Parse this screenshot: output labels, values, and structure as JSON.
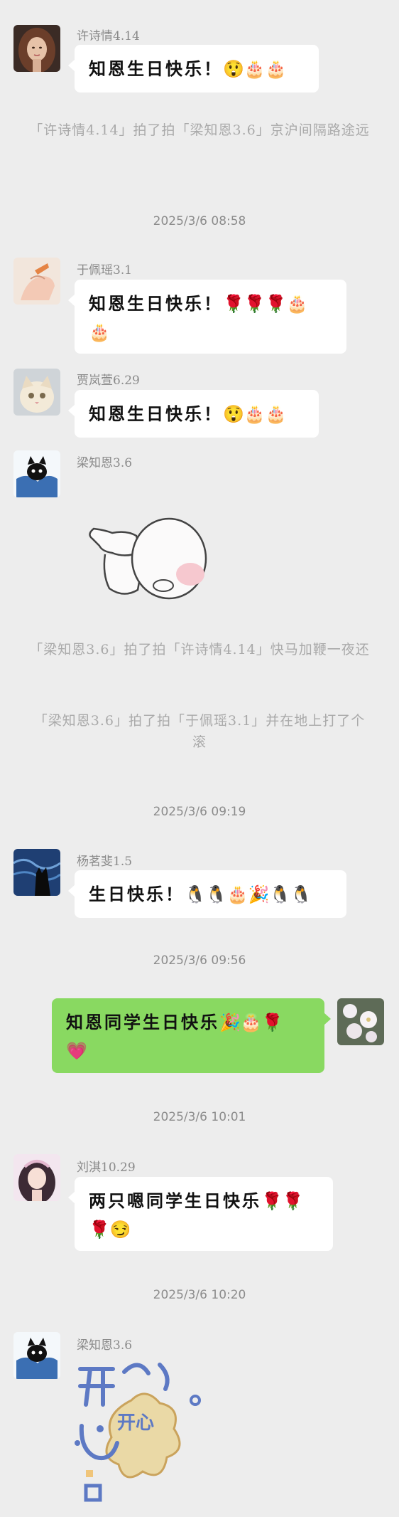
{
  "messages": [
    {
      "sender": "许诗情4.14",
      "text": "知恩生日快乐！",
      "emoji": "😲🎂🎂"
    },
    {
      "system": "「许诗情4.14」拍了拍「梁知恩3.6」京沪间隔路途远"
    },
    {
      "time": "2025/3/6 08:58"
    },
    {
      "sender": "于佩瑶3.1",
      "text": "知恩生日快乐！",
      "emoji": "🌹🌹🌹🎂🎂"
    },
    {
      "sender": "贾岚萱6.29",
      "text": "知恩生日快乐！",
      "emoji": "😲🎂🎂"
    },
    {
      "sender": "梁知恩3.6",
      "sticker": "bunny-bowing-sticker"
    },
    {
      "system": "「梁知恩3.6」拍了拍「许诗情4.14」快马加鞭一夜还"
    },
    {
      "system": "「梁知恩3.6」拍了拍「于佩瑶3.1」并在地上打了个滚"
    },
    {
      "time": "2025/3/6 09:19"
    },
    {
      "sender": "杨茗斐1.5",
      "text": "生日快乐！",
      "emoji": "🐧🐧🎂🎉🐧🐧"
    },
    {
      "time": "2025/3/6 09:56"
    },
    {
      "self": true,
      "text": "知恩同学生日快乐",
      "emoji": "🎉🎂🌹💗"
    },
    {
      "time": "2025/3/6 10:01"
    },
    {
      "sender": "刘淇10.29",
      "text": "两只嗯同学生日快乐",
      "emoji": "🌹🌹🌹😏"
    },
    {
      "time": "2025/3/6 10:20"
    },
    {
      "sender": "梁知恩3.6",
      "sticker": "kaixin-sticker",
      "sticker_text": "开心"
    }
  ],
  "m0": {
    "sender": "许诗情4.14",
    "text": "知恩生日快乐！",
    "emoji": "😲🎂🎂"
  },
  "sys1": "「许诗情4.14」拍了拍「梁知恩3.6」京沪间隔路途远",
  "t1": "2025/3/6 08:58",
  "m1": {
    "sender": "于佩瑶3.1",
    "text": "知恩生日快乐！",
    "emoji1": "🌹🌹🌹🎂",
    "emoji2": "🎂"
  },
  "m2": {
    "sender": "贾岚萱6.29",
    "text": "知恩生日快乐！",
    "emoji": "😲🎂🎂"
  },
  "m3": {
    "sender": "梁知恩3.6"
  },
  "sys2": "「梁知恩3.6」拍了拍「许诗情4.14」快马加鞭一夜还",
  "sys3": "「梁知恩3.6」拍了拍「于佩瑶3.1」并在地上打了个滚",
  "t2": "2025/3/6 09:19",
  "m4": {
    "sender": "杨茗斐1.5",
    "text": "生日快乐！",
    "emoji": "🐧🐧🎂🎉🐧🐧"
  },
  "t3": "2025/3/6 09:56",
  "m5": {
    "text": "知恩同学生日快乐",
    "emoji1": "🎉🎂🌹",
    "emoji2": "💗"
  },
  "t4": "2025/3/6 10:01",
  "m6": {
    "sender": "刘淇10.29",
    "text": "两只嗯同学生日快乐",
    "emoji1": "🌹🌹",
    "emoji2": "🌹😏"
  },
  "t5": "2025/3/6 10:20",
  "m7": {
    "sender": "梁知恩3.6",
    "sticker_text": "开心"
  },
  "colors": {
    "background": "#ededed",
    "bubble_other": "#ffffff",
    "bubble_self": "#89d961",
    "meta_text": "#8c8c8c"
  }
}
